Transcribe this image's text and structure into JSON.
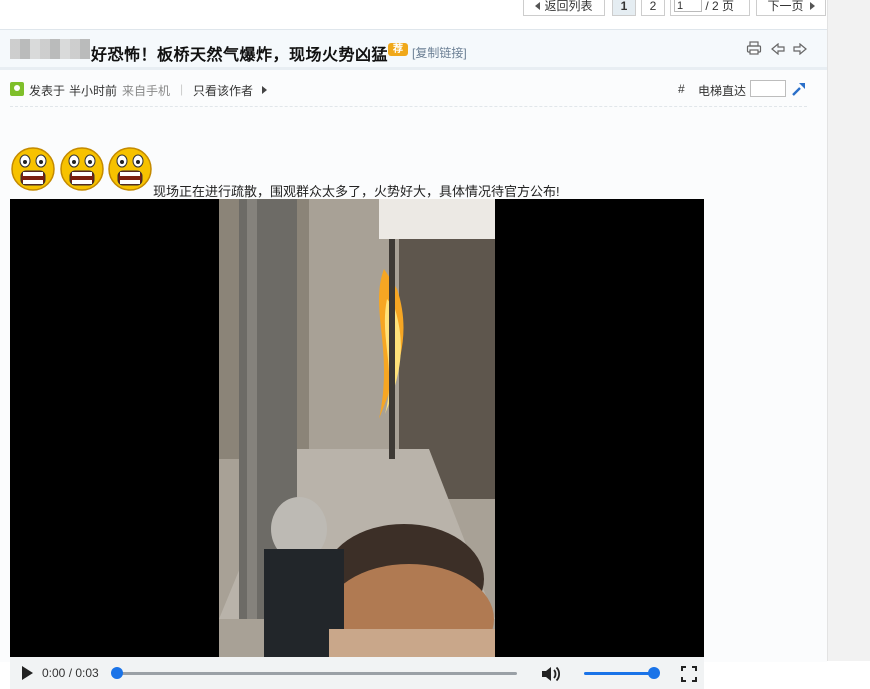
{
  "pager": {
    "back_label": "返回列表",
    "current_page": "1",
    "page2": "2",
    "page_input": "1",
    "total_label": "/ 2 页",
    "next_label": "下一页"
  },
  "post": {
    "title": "好恐怖！板桥天然气爆炸，现场火势凶猛",
    "rec_badge": "荐",
    "copy_link": "[复制链接]"
  },
  "meta": {
    "posted_label": "发表于",
    "time": "半小时前",
    "source": "来自手机",
    "separator": "|",
    "only_author": "只看该作者",
    "hash": "#",
    "elevator": "电梯直达"
  },
  "body": {
    "message": "现场正在进行疏散，围观群众太多了，火势好大，具体情况待官方公布!"
  },
  "video": {
    "time": "0:00 / 0:03",
    "progress": 0.0,
    "volume": 1.0
  },
  "colors": {
    "accent": "#1a73e8",
    "badge": "#f0a81a",
    "avatar": "#7fbf2b"
  }
}
